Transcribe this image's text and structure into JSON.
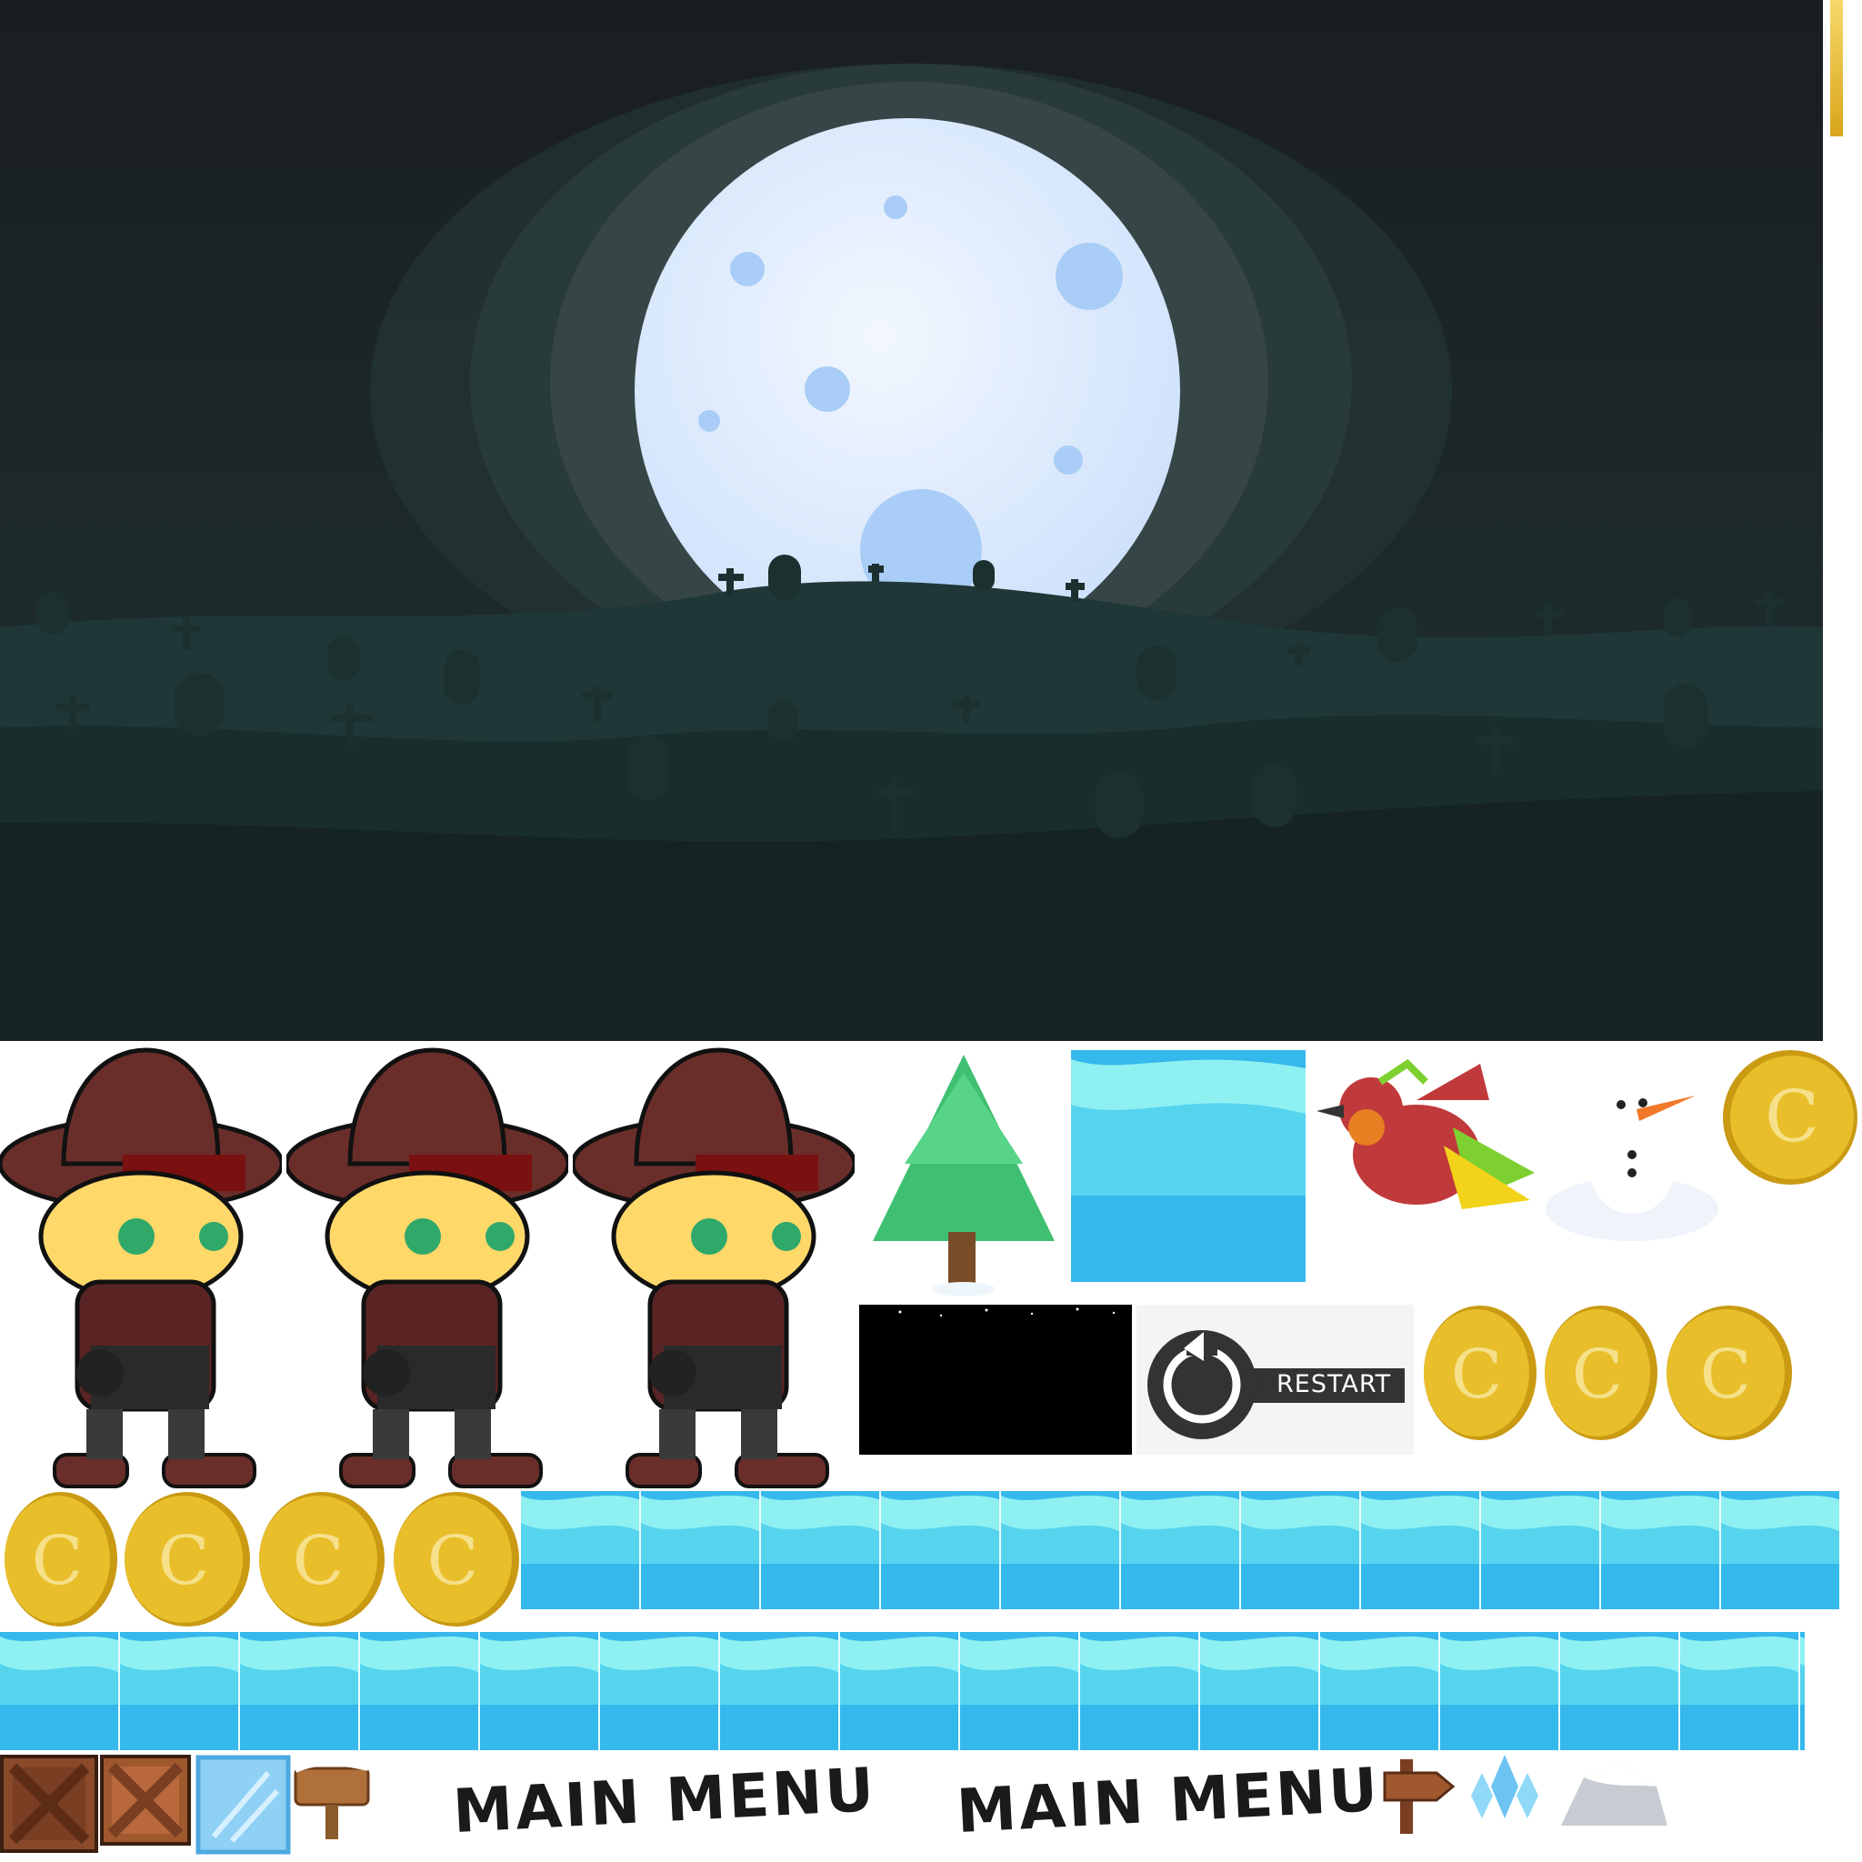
{
  "scene": {
    "sky_top": "#1a1e20",
    "sky_bottom": "#1f3030",
    "moon_color": "#dceaff",
    "hill_back": "#1d3434",
    "hill_mid": "#182a2a",
    "hill_front": "#152222"
  },
  "sprites": {
    "cowboy_frames": [
      "cowboy-frame-1",
      "cowboy-frame-2",
      "cowboy-frame-3"
    ],
    "restart_label": "RESTART",
    "main_menu_labels": [
      "MAIN MENU",
      "MAIN MENU"
    ],
    "icons": [
      "pine-tree-icon",
      "water-tile-icon",
      "red-bird-icon",
      "snowman-icon",
      "gold-coin-icon",
      "starry-night-tile",
      "restart-button-icon",
      "wooden-crate-icon",
      "ice-block-icon",
      "wooden-sign-icon",
      "arrow-signpost-icon",
      "ice-crystal-icon",
      "snow-rock-icon"
    ]
  },
  "colors": {
    "coin": "#e8bf2a",
    "coin_rim": "#c99a12",
    "water_light": "#8ff0f2",
    "water_mid": "#56d4ee",
    "water_dark": "#35b8eb",
    "hat": "#6a2e2a",
    "hat_band": "#7a1010",
    "jacket": "#5a2424"
  }
}
